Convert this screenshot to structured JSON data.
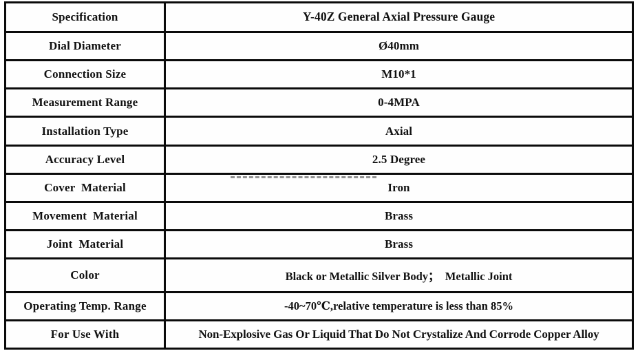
{
  "document": {
    "type": "specification-table",
    "title_row_label": "Specification",
    "title_row_value": "Y-40Z General Axial Pressure Gauge",
    "border_color": "#0b0b0b",
    "background_color": "#ffffff",
    "text_color": "#111111",
    "artifact_color": "#8d8d8d"
  },
  "table": {
    "columns": 2,
    "rows": [
      {
        "label": "Specification",
        "value": "Y-40Z General Axial Pressure Gauge"
      },
      {
        "label": "Dial Diameter",
        "value": "Ø40mm"
      },
      {
        "label": "Connection Size",
        "value": "M10*1"
      },
      {
        "label": "Measurement Range",
        "value": "0-4MPA"
      },
      {
        "label": "Installation Type",
        "value": "Axial"
      },
      {
        "label": "Accuracy Level",
        "value": "2.5 Degree"
      },
      {
        "label": "Cover  Material",
        "value": "Iron"
      },
      {
        "label": "Movement  Material",
        "value": "Brass"
      },
      {
        "label": "Joint  Material",
        "value": "Brass"
      },
      {
        "label": "Color",
        "value": "Black or Metallic Silver Body；  Metallic Joint"
      },
      {
        "label": "Operating Temp. Range",
        "value": "-40~70℃,relative temperature is less than 85%"
      },
      {
        "label": "For Use With",
        "value": "Non-Explosive Gas Or Liquid That Do Not Crystalize And Corrode Copper Alloy"
      }
    ]
  }
}
